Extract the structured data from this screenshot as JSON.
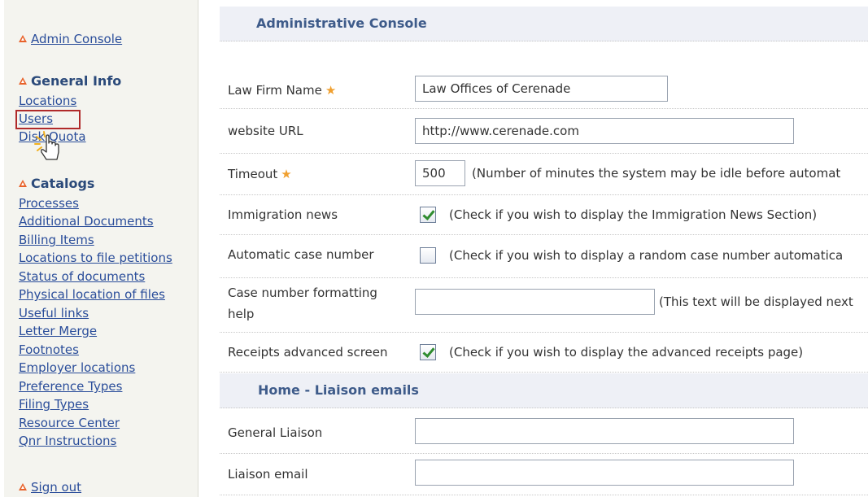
{
  "sidebar": {
    "admin_console": "Admin Console",
    "general_info": {
      "heading": "General Info",
      "items": [
        "Locations",
        "Users",
        "Disk Quota"
      ]
    },
    "catalogs": {
      "heading": "Catalogs",
      "items": [
        "Processes",
        "Additional Documents",
        "Billing Items",
        "Locations to file petitions",
        "Status of documents",
        "Physical location of files",
        "Useful links",
        "Letter Merge",
        "Footnotes",
        "Employer locations",
        "Preference Types",
        "Filing Types",
        "Resource Center",
        "Qnr Instructions"
      ]
    },
    "sign_out": "Sign out"
  },
  "main": {
    "section_title": "Administrative Console",
    "fields": {
      "law_firm_name": {
        "label": "Law Firm Name",
        "value": "Law Offices of Cerenade"
      },
      "website_url": {
        "label": "website URL",
        "value": "http://www.cerenade.com"
      },
      "timeout": {
        "label": "Timeout",
        "value": "500",
        "hint": "(Number of minutes the system may be idle before automat"
      },
      "immigration_news": {
        "label": "Immigration news",
        "checked": true,
        "hint": "(Check if you wish to display the Immigration News Section)"
      },
      "automatic_case_number": {
        "label": "Automatic case number",
        "checked": false,
        "hint": "(Check if you wish to display a random case number automatica"
      },
      "case_number_help": {
        "label_line1": "Case number formatting",
        "label_line2": "help",
        "value": "",
        "hint": "(This text will be displayed next"
      },
      "receipts_advanced": {
        "label": "Receipts advanced screen",
        "checked": true,
        "hint": "(Check if you wish to display the advanced receipts page)"
      }
    },
    "liaison_section_title": "Home - Liaison emails",
    "liaison": {
      "general_liaison": {
        "label": "General Liaison",
        "value": ""
      },
      "liaison_email": {
        "label": "Liaison email",
        "value": ""
      }
    }
  },
  "colors": {
    "link": "#2a4d9a",
    "heading": "#2b4a7a",
    "accent_triangle": "#e8622a",
    "required_star": "#f0a030",
    "highlight_box": "#b02a2a",
    "checkmark": "#2f8c2f"
  },
  "icons": {
    "section_marker": "triangle-icon",
    "required": "star-icon",
    "cursor": "hand-pointer-icon"
  }
}
